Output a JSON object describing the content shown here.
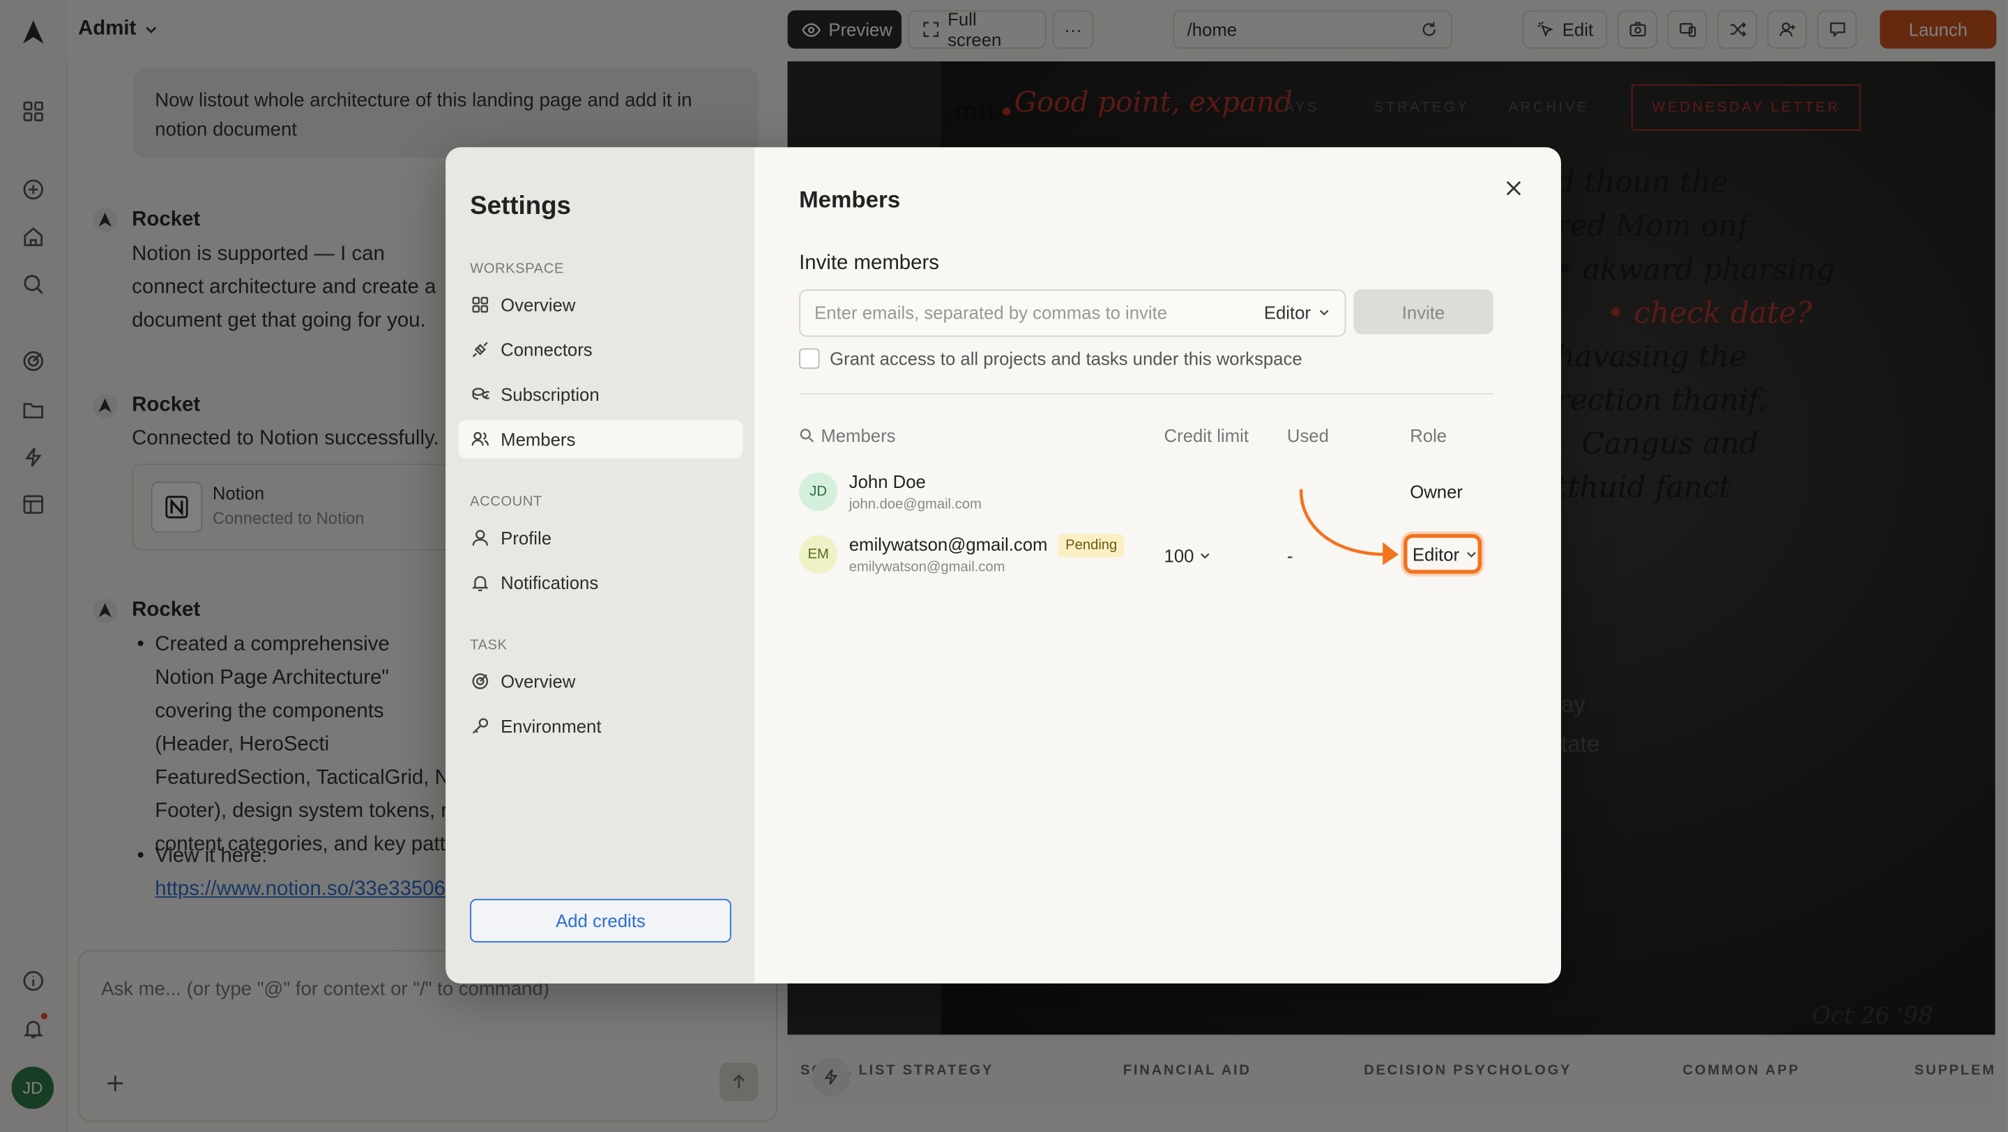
{
  "app": {
    "workspace_name": "Admit",
    "avatar_initials": "JD"
  },
  "toolbar": {
    "preview": "Preview",
    "full_screen": "Full screen",
    "more": "···",
    "url": "/home",
    "edit": "Edit",
    "launch": "Launch"
  },
  "chat": {
    "user_message": "Now listout whole architecture of this landing page and add it in notion document",
    "messages": [
      {
        "author": "Rocket",
        "text": "Notion is supported — I can connect architecture and create a document get that going for you."
      },
      {
        "author": "Rocket",
        "text": "Connected to Notion successfully."
      },
      {
        "author": "Rocket"
      }
    ],
    "notion_card": {
      "title": "Notion",
      "subtitle": "Connected to Notion"
    },
    "bullet1": "Created a comprehensive Notion Page Architecture\" covering the components (Header, HeroSecti FeaturedSection, TacticalGrid, N Footer), design system tokens, r content categories, and key patt",
    "bullet2_label": "View it here:",
    "link": "https://www.notion.so/33e33506",
    "input_placeholder": "Ask me... (or type \"@\" for context or \"/\" to command)"
  },
  "preview": {
    "nav_logo": "mit",
    "handwritten_note": "Good point, expand",
    "nav_items": [
      "AYS",
      "STRATEGY",
      "ARCHIVE"
    ],
    "cta": "WEDNESDAY LETTER",
    "hand_lines": [
      "d thoun the",
      "red Mom onf",
      "• akward pharsing",
      "• check date?",
      "havasing the",
      "rection thanif.",
      "Cangus and",
      "tthuid fanct"
    ],
    "faded_texts": [
      "ay",
      "tate"
    ],
    "date_note": "Oct 26 '98",
    "ticker": [
      "SC OL LIST STRATEGY",
      "FINANCIAL AID",
      "DECISION PSYCHOLOGY",
      "COMMON APP",
      "SUPPLEM"
    ]
  },
  "settings": {
    "title": "Settings",
    "sections": [
      {
        "label": "WORKSPACE",
        "items": [
          "Overview",
          "Connectors",
          "Subscription",
          "Members"
        ]
      },
      {
        "label": "ACCOUNT",
        "items": [
          "Profile",
          "Notifications"
        ]
      },
      {
        "label": "TASK",
        "items": [
          "Overview",
          "Environment"
        ]
      }
    ],
    "add_credits": "Add credits",
    "members": {
      "heading": "Members",
      "invite_heading": "Invite members",
      "invite_placeholder": "Enter emails, separated by commas to invite",
      "invite_role": "Editor",
      "invite_button": "Invite",
      "grant_label": "Grant access to all projects and tasks under this workspace",
      "columns": [
        "Members",
        "Credit limit",
        "Used",
        "Role"
      ],
      "rows": [
        {
          "initials": "JD",
          "name": "John Doe",
          "email": "john.doe@gmail.com",
          "credit": "",
          "used": "",
          "role": "Owner"
        },
        {
          "initials": "EM",
          "name": "emilywatson@gmail.com",
          "badge": "Pending",
          "email": "emilywatson@gmail.com",
          "credit": "100",
          "used": "-",
          "role": "Editor"
        }
      ]
    }
  },
  "colors": {
    "accent": "#f2741f",
    "launch": "#c9531f",
    "link": "#2a6ed4",
    "red_ink": "#b8342d"
  }
}
